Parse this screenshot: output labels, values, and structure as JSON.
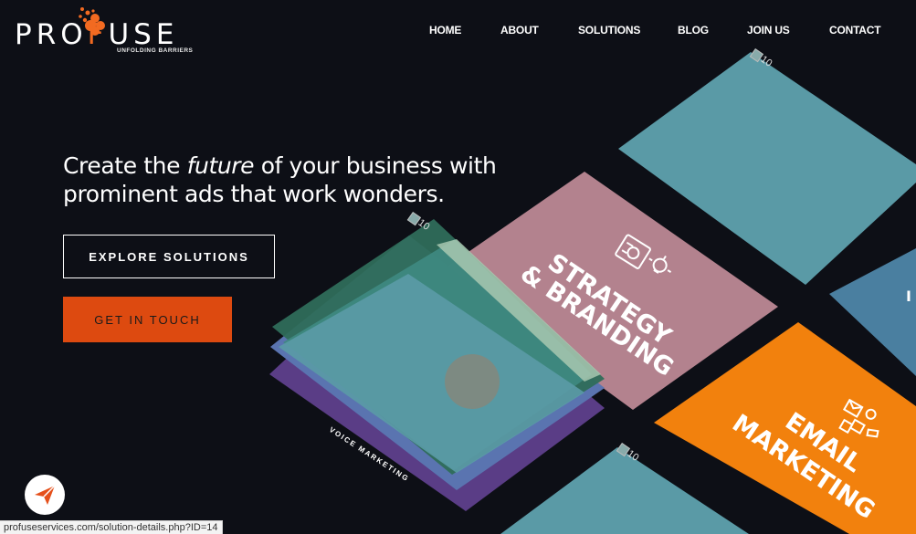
{
  "brand": {
    "logo_pre": "PRO",
    "logo_o": "F",
    "logo_post": "USE",
    "tagline": "UNFOLDING BARRIERS",
    "accent_color": "#f26a21"
  },
  "nav": {
    "items": [
      {
        "label": "HOME"
      },
      {
        "label": "ABOUT"
      },
      {
        "label": "SOLUTIONS"
      },
      {
        "label": "BLOG"
      },
      {
        "label": "JOIN US"
      },
      {
        "label": "CONTACT"
      }
    ]
  },
  "hero": {
    "line1_pre": "Create the ",
    "line1_em": "future",
    "line1_post": " of your business with",
    "line2": "prominent ads that work wonders."
  },
  "buttons": {
    "explore": "EXPLORE SOLUTIONS",
    "touch": "GET IN TOUCH",
    "touch_color": "#dd4a10"
  },
  "tiles": {
    "strategy_line1": "STRATEGY",
    "strategy_line2": "& BRANDING",
    "email_line1": "EMAIL",
    "email_line2": "MARKETING",
    "voice": "VOICE MARKETING",
    "broken_image_alt": "10",
    "colors": {
      "teal": "#5a9aa6",
      "pink": "#b3828e",
      "orange": "#f2810d",
      "blue": "#4a7fa0"
    }
  },
  "float_button": {
    "icon": "paper-plane-icon"
  },
  "status_bar": {
    "url": "profuseservices.com/solution-details.php?ID=14"
  }
}
